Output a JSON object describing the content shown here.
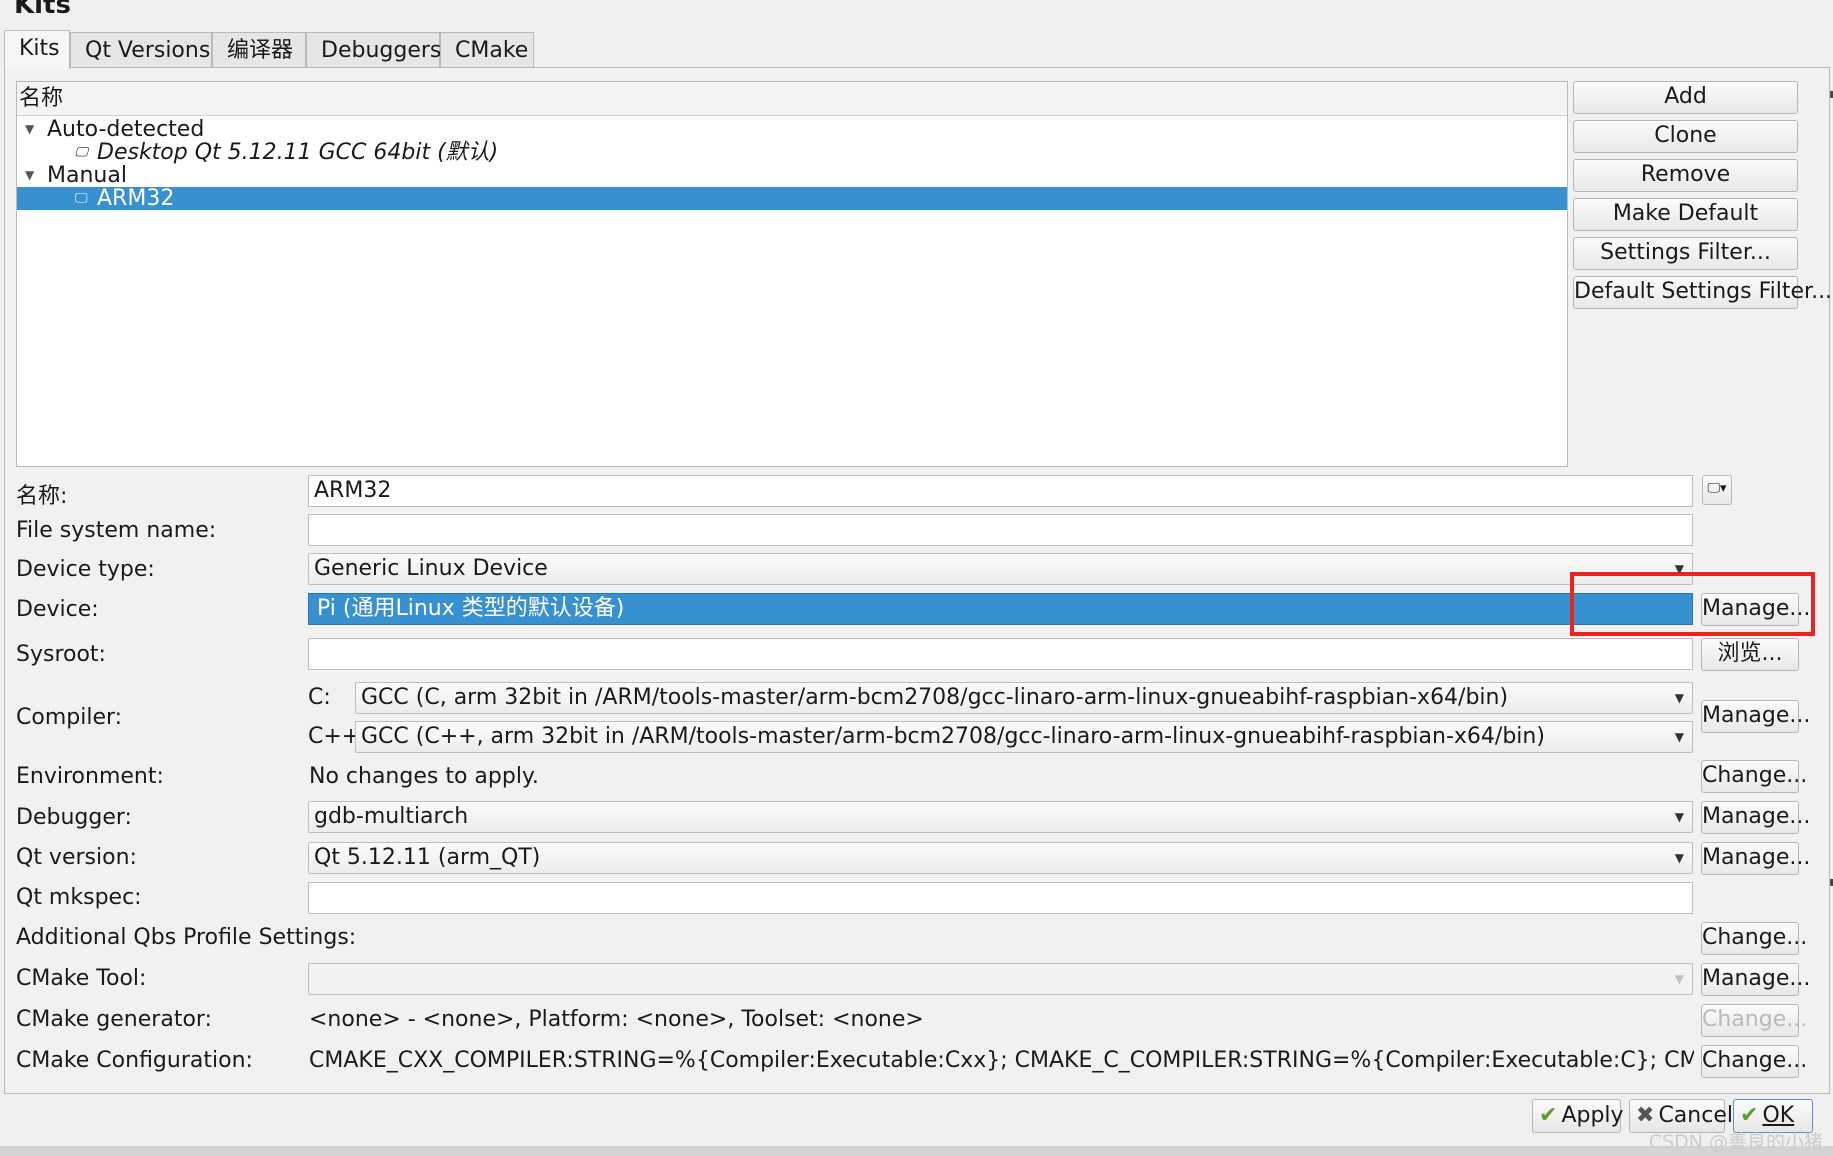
{
  "dialog": {
    "title": "Kits"
  },
  "tabs": [
    "Kits",
    "Qt Versions",
    "编译器",
    "Debuggers",
    "CMake"
  ],
  "tree": {
    "header": "名称",
    "rows": [
      {
        "label": "Auto-detected"
      },
      {
        "label": "Desktop Qt 5.12.11 GCC 64bit (默认)"
      },
      {
        "label": "Manual"
      },
      {
        "label": "ARM32"
      }
    ]
  },
  "side_buttons": [
    "Add",
    "Clone",
    "Remove",
    "Make Default",
    "Settings Filter...",
    "Default Settings Filter..."
  ],
  "form": {
    "name": {
      "label": "名称:",
      "value": "ARM32"
    },
    "fs_name": {
      "label": "File system name:",
      "value": ""
    },
    "device_type": {
      "label": "Device type:",
      "value": "Generic Linux Device"
    },
    "device": {
      "label": "Device:",
      "value": "Pi (通用Linux 类型的默认设备)",
      "button": "Manage..."
    },
    "sysroot": {
      "label": "Sysroot:",
      "value": "",
      "button": "浏览..."
    },
    "compiler": {
      "label": "Compiler:",
      "c_label": "C:",
      "c_value": "GCC (C, arm 32bit in /ARM/tools-master/arm-bcm2708/gcc-linaro-arm-linux-gnueabihf-raspbian-x64/bin)",
      "cpp_label": "C++:",
      "cpp_value": "GCC (C++, arm 32bit in /ARM/tools-master/arm-bcm2708/gcc-linaro-arm-linux-gnueabihf-raspbian-x64/bin)",
      "button": "Manage..."
    },
    "environment": {
      "label": "Environment:",
      "value": "No changes to apply.",
      "button": "Change..."
    },
    "debugger": {
      "label": "Debugger:",
      "value": "gdb-multiarch",
      "button": "Manage..."
    },
    "qt_version": {
      "label": "Qt version:",
      "value": "Qt 5.12.11 (arm_QT)",
      "button": "Manage..."
    },
    "qt_mkspec": {
      "label": "Qt mkspec:",
      "value": ""
    },
    "qbs": {
      "label": "Additional Qbs Profile Settings:",
      "button": "Change..."
    },
    "cmake_tool": {
      "label": "CMake Tool:",
      "value": "",
      "button": "Manage..."
    },
    "cmake_generator": {
      "label": "CMake generator:",
      "value": "<none> - <none>, Platform: <none>, Toolset: <none>",
      "button": "Change..."
    },
    "cmake_config": {
      "label": "CMake Configuration:",
      "value": "CMAKE_CXX_COMPILER:STRING=%{Compiler:Executable:Cxx}; CMAKE_C_COMPILER:STRING=%{Compiler:Executable:C}; CMAKE_PREFIX_PATH:STRIN...",
      "button": "Change..."
    }
  },
  "footer": {
    "apply": "Apply",
    "cancel": "Cancel",
    "ok": "OK"
  },
  "watermark": "CSDN @善良的小猪",
  "colors": {
    "selection": "#3790d0",
    "highlight_box": "#e8251f"
  }
}
